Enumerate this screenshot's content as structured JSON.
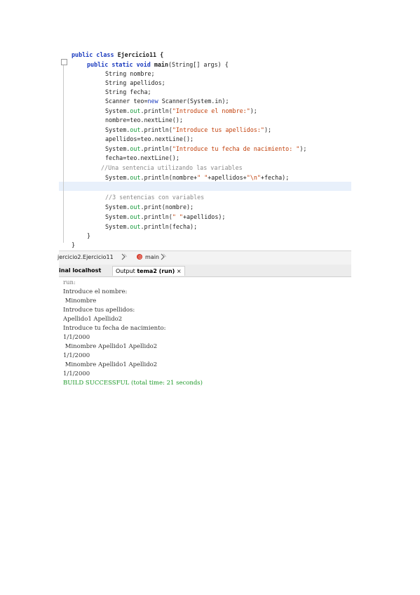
{
  "editor": {
    "class_decl": {
      "kw": "public class",
      "name": "Ejercicio11 {"
    },
    "main_decl": {
      "kw1": "public",
      "kw2": "static",
      "kw3": "void",
      "name": "main",
      "rest": "(String[] args) {"
    },
    "lines": [
      "String nombre;",
      "String apellidos;",
      "String fecha;"
    ],
    "scanner": {
      "pre": "Scanner teo=",
      "kw": "new",
      "post": " Scanner(System.in);"
    },
    "println1": {
      "pre": "System.",
      "fld": "out",
      "mid": ".println(",
      "str": "\"Introduce el nombre:\"",
      "post": ");"
    },
    "read1": "nombre=teo.nextLine();",
    "println2": {
      "pre": "System.",
      "fld": "out",
      "mid": ".println(",
      "str": "\"Introduce tus apellidos:\"",
      "post": ");"
    },
    "read2": "apellidos=teo.nextLine();",
    "println3": {
      "pre": "System.",
      "fld": "out",
      "mid": ".println(",
      "str": "\"Introduce tu fecha de nacimiento: \"",
      "post": ");"
    },
    "read3": "fecha=teo.nextLine();",
    "comment1": "//Una sentencia utilizando las variables",
    "println4": {
      "pre": "System.",
      "fld": "out",
      "mid": ".println(nombre+",
      "str1": "\" \"",
      "mid2": "+apellidos+",
      "str2": "\"\\n\"",
      "post": "+fecha);"
    },
    "comment2": "//3 sentencias con variables",
    "print5": {
      "pre": "System.",
      "fld": "out",
      "post": ".print(nombre);"
    },
    "println6": {
      "pre": "System.",
      "fld": "out",
      "mid": ".println(",
      "str": "\" \"",
      "post": "+apellidos);"
    },
    "println7": {
      "pre": "System.",
      "fld": "out",
      "post": ".println(fecha);"
    },
    "close_inner": "}",
    "close_outer": "}"
  },
  "breadcrumb": {
    "class_path": "jercicio2.Ejercicio11",
    "method": "main"
  },
  "tabs": {
    "terminal": "inal  localhost",
    "output_label": "Output",
    "output_name": "tema2 (run)",
    "close": "×"
  },
  "output": {
    "lines": [
      {
        "text": "run:",
        "type": "run"
      },
      {
        "text": "Introduce el nombre:",
        "type": "normal"
      },
      {
        "text": " Minombre",
        "type": "normal"
      },
      {
        "text": "Introduce tus apellidos:",
        "type": "normal"
      },
      {
        "text": "Apellido1 Apellido2",
        "type": "normal"
      },
      {
        "text": "Introduce tu fecha de nacimiento:",
        "type": "normal"
      },
      {
        "text": "1/1/2000",
        "type": "normal"
      },
      {
        "text": " Minombre Apellido1 Apellido2",
        "type": "normal"
      },
      {
        "text": "1/1/2000",
        "type": "normal"
      },
      {
        "text": " Minombre Apellido1 Apellido2",
        "type": "normal"
      },
      {
        "text": "1/1/2000",
        "type": "normal"
      },
      {
        "text": "BUILD SUCCESSFUL (total time: 21 seconds)",
        "type": "ok"
      }
    ]
  },
  "colors": {
    "keyword": "#1b3bbf",
    "string": "#c2410c",
    "field": "#159a3a",
    "comment": "#8a8a8a",
    "success": "#1f9a2a"
  }
}
